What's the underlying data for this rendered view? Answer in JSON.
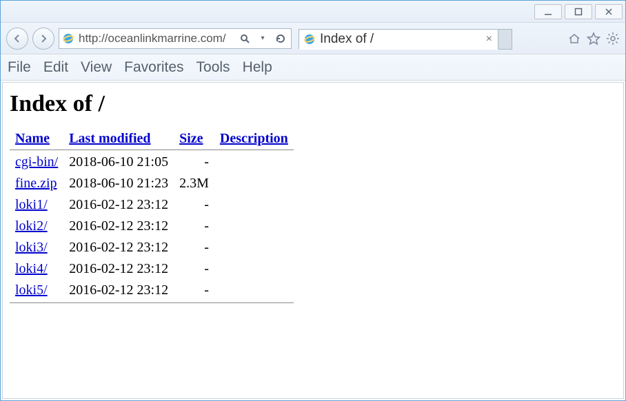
{
  "window": {
    "url": "http://oceanlinkmarrine.com/",
    "tab_title": "Index of /"
  },
  "menubar": [
    "File",
    "Edit",
    "View",
    "Favorites",
    "Tools",
    "Help"
  ],
  "page": {
    "heading": "Index of /",
    "columns": {
      "name": "Name",
      "modified": "Last modified",
      "size": "Size",
      "desc": "Description"
    },
    "rows": [
      {
        "name": "cgi-bin/",
        "modified": "2018-06-10 21:05",
        "size": "-",
        "desc": ""
      },
      {
        "name": "fine.zip",
        "modified": "2018-06-10 21:23",
        "size": "2.3M",
        "desc": ""
      },
      {
        "name": "loki1/",
        "modified": "2016-02-12 23:12",
        "size": "-",
        "desc": ""
      },
      {
        "name": "loki2/",
        "modified": "2016-02-12 23:12",
        "size": "-",
        "desc": ""
      },
      {
        "name": "loki3/",
        "modified": "2016-02-12 23:12",
        "size": "-",
        "desc": ""
      },
      {
        "name": "loki4/",
        "modified": "2016-02-12 23:12",
        "size": "-",
        "desc": ""
      },
      {
        "name": "loki5/",
        "modified": "2016-02-12 23:12",
        "size": "-",
        "desc": ""
      }
    ]
  }
}
